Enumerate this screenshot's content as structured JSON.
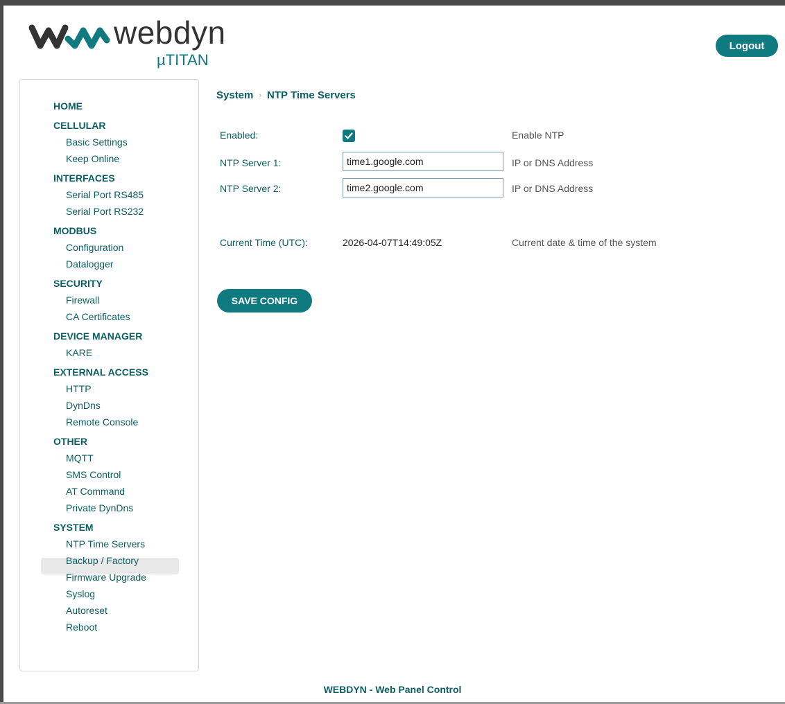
{
  "brand": {
    "name": "webdyn",
    "product": "µTITAN"
  },
  "header": {
    "logout_label": "Logout"
  },
  "sidebar": {
    "sections": [
      {
        "label": "HOME",
        "items": []
      },
      {
        "label": "CELLULAR",
        "items": [
          "Basic Settings",
          "Keep Online"
        ]
      },
      {
        "label": "INTERFACES",
        "items": [
          "Serial Port RS485",
          "Serial Port RS232"
        ]
      },
      {
        "label": "MODBUS",
        "items": [
          "Configuration",
          "Datalogger"
        ]
      },
      {
        "label": "SECURITY",
        "items": [
          "Firewall",
          "CA Certificates"
        ]
      },
      {
        "label": "DEVICE MANAGER",
        "items": [
          "KARE"
        ]
      },
      {
        "label": "EXTERNAL ACCESS",
        "items": [
          "HTTP",
          "DynDns",
          "Remote Console"
        ]
      },
      {
        "label": "OTHER",
        "items": [
          "MQTT",
          "SMS Control",
          "AT Command",
          "Private DynDns"
        ]
      },
      {
        "label": "SYSTEM",
        "items": [
          "NTP Time Servers",
          "Backup / Factory",
          "Firmware Upgrade",
          "Syslog",
          "Autoreset",
          "Reboot"
        ]
      }
    ],
    "active_item": "NTP Time Servers"
  },
  "breadcrumb": {
    "parent": "System",
    "current": "NTP Time Servers"
  },
  "form": {
    "enabled": {
      "label": "Enabled:",
      "checked": true,
      "hint": "Enable NTP"
    },
    "server1": {
      "label": "NTP Server 1:",
      "value": "time1.google.com",
      "hint": "IP or DNS Address"
    },
    "server2": {
      "label": "NTP Server 2:",
      "value": "time2.google.com",
      "hint": "IP or DNS Address"
    },
    "current_time": {
      "label": "Current Time (UTC):",
      "value": "2026-04-07T14:49:05Z",
      "hint": "Current date & time of the system"
    },
    "save_label": "SAVE CONFIG"
  },
  "footer": {
    "text": "WEBDYN - Web Panel Control"
  },
  "colors": {
    "accent": "#0f7a7f",
    "nav_text": "#0b5e63",
    "breadcrumb_separator": "#e0a24a"
  }
}
